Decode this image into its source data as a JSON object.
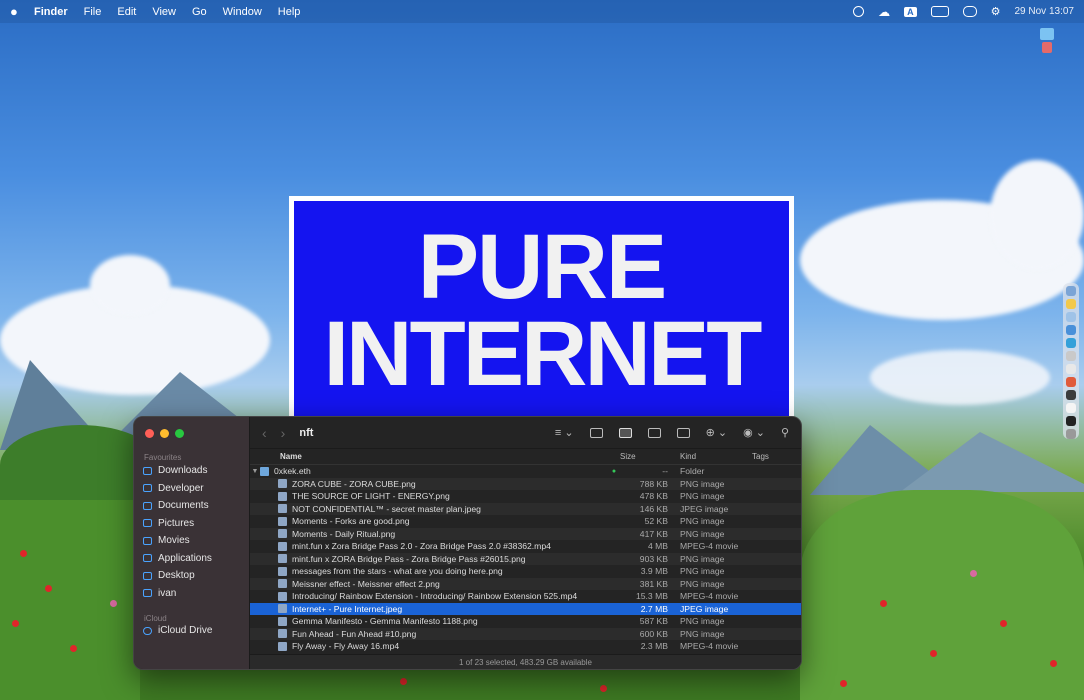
{
  "menubar": {
    "app": "Finder",
    "items": [
      "File",
      "Edit",
      "View",
      "Go",
      "Window",
      "Help"
    ],
    "status_icons": [
      "record-icon",
      "cloud-icon",
      "input-source-icon",
      "battery-icon",
      "screen-mirror-icon",
      "control-center-icon"
    ],
    "input_source": "A",
    "clock": "29 Nov  13:07"
  },
  "poster": {
    "line1": "PURE",
    "line2": "INTERNET",
    "bg_color": "#1414f0"
  },
  "finder": {
    "title": "nft",
    "sidebar": {
      "favourites_header": "Favourites",
      "favourites": [
        "Downloads",
        "Developer",
        "Documents",
        "Pictures",
        "Movies",
        "Applications",
        "Desktop",
        "ivan"
      ],
      "icloud_header": "iCloud",
      "icloud": [
        "iCloud Drive"
      ]
    },
    "columns": {
      "name": "Name",
      "size": "Size",
      "kind": "Kind",
      "tags": "Tags"
    },
    "folder_row": {
      "name": "0xkek.eth",
      "size": "--",
      "kind": "Folder"
    },
    "files": [
      {
        "name": "ZORA CUBE - ZORA CUBE.png",
        "size": "788 KB",
        "kind": "PNG image"
      },
      {
        "name": "THE SOURCE OF LIGHT - ENERGY.png",
        "size": "478 KB",
        "kind": "PNG image"
      },
      {
        "name": "NOT CONFIDENTIAL™ - secret master plan.jpeg",
        "size": "146 KB",
        "kind": "JPEG image"
      },
      {
        "name": "Moments - Forks are good.png",
        "size": "52 KB",
        "kind": "PNG image"
      },
      {
        "name": "Moments - Daily   Ritual.png",
        "size": "417 KB",
        "kind": "PNG image"
      },
      {
        "name": "mint.fun x Zora Bridge Pass 2.0 - Zora Bridge Pass 2.0 #38362.mp4",
        "size": "4 MB",
        "kind": "MPEG-4 movie"
      },
      {
        "name": "mint.fun x ZORA Bridge Pass - Zora Bridge Pass #26015.png",
        "size": "903 KB",
        "kind": "PNG image"
      },
      {
        "name": "messages from the stars - what are you doing here.png",
        "size": "3.9 MB",
        "kind": "PNG image"
      },
      {
        "name": "Meissner effect - Meissner effect 2.png",
        "size": "381 KB",
        "kind": "PNG image"
      },
      {
        "name": "Introducing/ Rainbow Extension - Introducing/ Rainbow Extension 525.mp4",
        "size": "15.3 MB",
        "kind": "MPEG-4 movie"
      },
      {
        "name": "Internet+ - Pure Internet.jpeg",
        "size": "2.7 MB",
        "kind": "JPEG image",
        "selected": true
      },
      {
        "name": "Gemma Manifesto - Gemma Manifesto 1188.png",
        "size": "587 KB",
        "kind": "PNG image"
      },
      {
        "name": "Fun Ahead - Fun Ahead #10.png",
        "size": "600 KB",
        "kind": "PNG image"
      },
      {
        "name": "Fly Away - Fly Away 16.mp4",
        "size": "2.3 MB",
        "kind": "MPEG-4 movie"
      }
    ],
    "status": "1 of 23 selected, 483.29 GB available"
  }
}
